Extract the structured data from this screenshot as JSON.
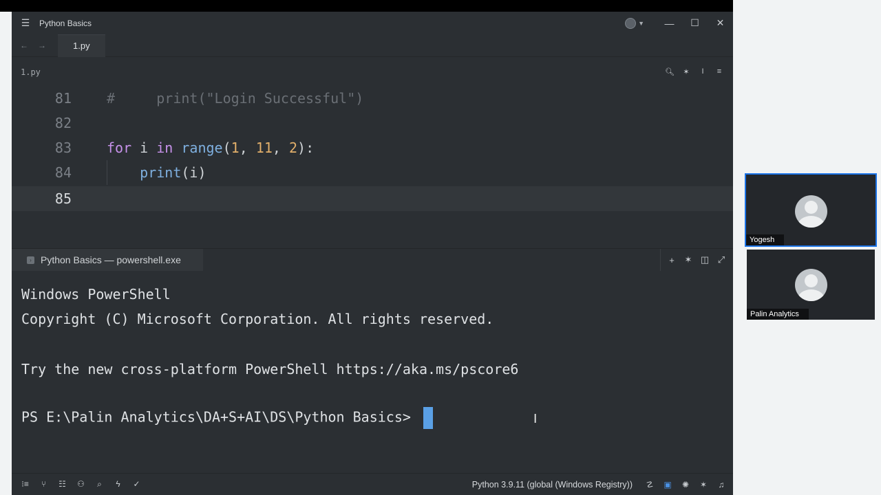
{
  "window": {
    "title": "Python Basics",
    "menu_icon": "hamburger-icon",
    "controls": [
      "minimize-icon",
      "maximize-icon",
      "close-icon"
    ]
  },
  "tabs": [
    {
      "label": "1.py",
      "active": true
    }
  ],
  "editor": {
    "filename": "1.py",
    "toolbar_icons": [
      "search-icon",
      "sparkle-icon",
      "cursor-icon",
      "settings-sliders-icon"
    ],
    "lines": [
      {
        "number": "81",
        "text": "#     print(\"Login Successful\")"
      },
      {
        "number": "82",
        "text": ""
      },
      {
        "number": "83",
        "text": "for i in range(1, 11, 2):"
      },
      {
        "number": "84",
        "text": "    print(i)"
      },
      {
        "number": "85",
        "text": ""
      }
    ],
    "active_line": "85"
  },
  "terminal": {
    "tab_label": "Python Basics — powershell.exe",
    "tool_icons": [
      "plus-icon",
      "sparkle-icon",
      "split-icon",
      "expand-icon"
    ],
    "lines": [
      "Windows PowerShell",
      "Copyright (C) Microsoft Corporation. All rights reserved.",
      "",
      "Try the new cross-platform PowerShell https://aka.ms/pscore6",
      "",
      "PS E:\\Palin Analytics\\DA+S+AI\\DS\\Python Basics> "
    ]
  },
  "statusbar": {
    "interpreter": "Python 3.9.11 (global (Windows Registry))"
  },
  "participants": [
    {
      "name": "Yogesh",
      "speaking": true
    },
    {
      "name": "Palin Analytics",
      "speaking": false
    }
  ],
  "colors": {
    "app_bg": "#2b2f33",
    "keyword": "#c792ea",
    "function": "#7fb0e0",
    "number": "#e3b06b",
    "comment": "#6a6f75",
    "cursor": "#5aa0e6",
    "speaker_border": "#1a73e8"
  }
}
